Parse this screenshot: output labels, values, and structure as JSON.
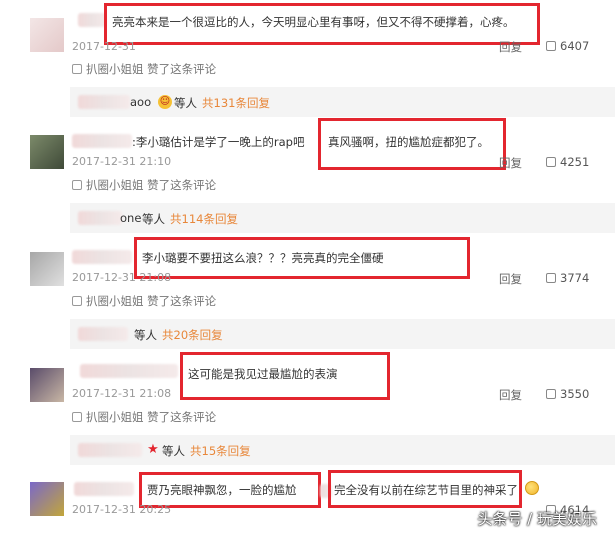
{
  "comments": [
    {
      "segments": [
        "亮亮本来是一个很逗比的人，今天明显心里有事呀，但又不得不硬撑着，心疼。"
      ],
      "time": "2017-12-31",
      "reply": "回复",
      "likes": "6407",
      "liked_by": "扒圈小姐姐 赞了这条评论",
      "strip": {
        "who_suffix": "aoo",
        "et": "等人",
        "count": "共131条回复"
      }
    },
    {
      "prefix": ":李小璐估计是学了一晚上的rap吧",
      "segments": [
        "真风骚啊，扭的尴尬症都犯了。"
      ],
      "time": "2017-12-31 21:10",
      "reply": "回复",
      "likes": "4251",
      "liked_by": "扒圈小姐姐 赞了这条评论",
      "strip": {
        "who_suffix": "one",
        "et": "等人",
        "count": "共114条回复"
      }
    },
    {
      "segments": [
        "李小璐要不要扭这么浪？？？亮亮真的完全僵硬"
      ],
      "time": "2017-12-31 21:08",
      "reply": "回复",
      "likes": "3774",
      "liked_by": "扒圈小姐姐 赞了这条评论",
      "strip": {
        "who_suffix": "",
        "et": "等人",
        "count": "共20条回复"
      }
    },
    {
      "segments": [
        "这可能是我见过最尴尬的表演"
      ],
      "time": "2017-12-31 21:08",
      "reply": "回复",
      "likes": "3550",
      "liked_by": "扒圈小姐姐 赞了这条评论",
      "strip": {
        "who_suffix": "",
        "et": "等人",
        "count": "共15条回复"
      }
    },
    {
      "segments": [
        "贾乃亮眼神飘忽，一脸的尴尬",
        "完全没有以前在综艺节目里的神采了"
      ],
      "time": "2017-12-31 20:25",
      "reply": "回复",
      "likes": "4614"
    }
  ],
  "watermark": "头条号 / 玩美娱乐",
  "colors": {
    "highlight": "#e3262f",
    "reply_count": "#e8873a",
    "time": "#999999"
  }
}
